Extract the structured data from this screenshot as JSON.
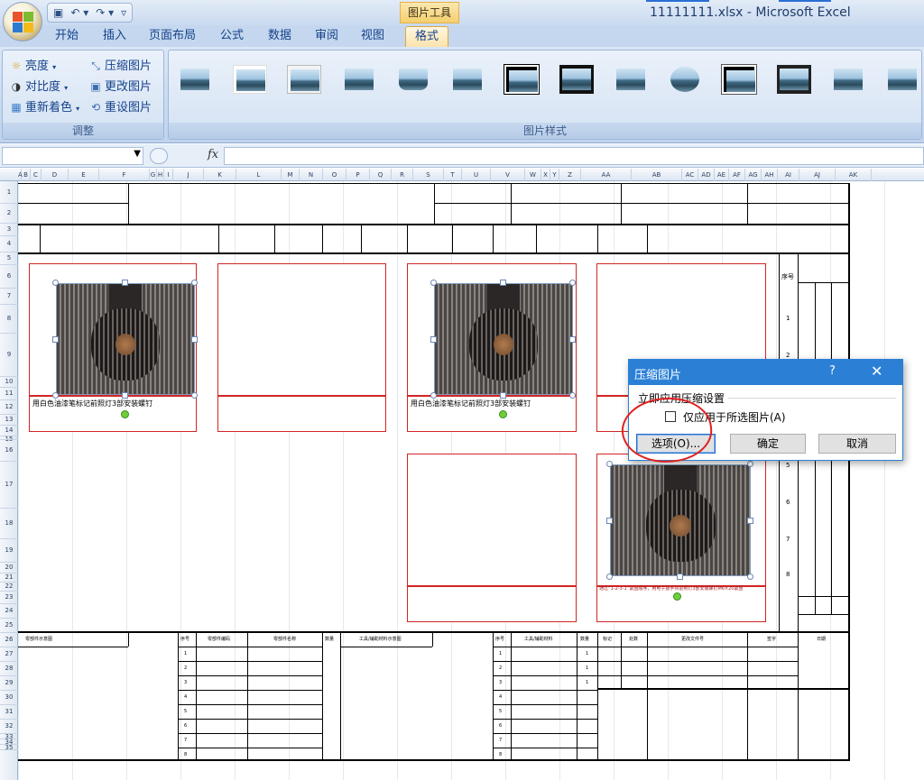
{
  "window": {
    "title": "11111111.xlsx - Microsoft Excel",
    "context_tool": "图片工具"
  },
  "tabs": [
    {
      "label": "开始"
    },
    {
      "label": "插入"
    },
    {
      "label": "页面布局"
    },
    {
      "label": "公式"
    },
    {
      "label": "数据"
    },
    {
      "label": "审阅"
    },
    {
      "label": "视图"
    },
    {
      "label": "格式",
      "active": true
    }
  ],
  "ribbon": {
    "adjust": {
      "brightness": "亮度",
      "contrast": "对比度",
      "recolor": "重新着色",
      "compress": "压缩图片",
      "change": "更改图片",
      "reset": "重设图片",
      "group_label": "调整"
    },
    "styles": {
      "group_label": "图片样式",
      "count": 14
    }
  },
  "formula_bar": {
    "fx": "fx",
    "name_value": "",
    "formula_value": ""
  },
  "sheet": {
    "columns": [
      "A",
      "B",
      "C",
      "D",
      "E",
      "F",
      "G",
      "H",
      "I",
      "J",
      "K",
      "L",
      "M",
      "N",
      "O",
      "P",
      "Q",
      "R",
      "S",
      "T",
      "U",
      "V",
      "W",
      "X",
      "Y",
      "Z",
      "AA",
      "AB",
      "AC",
      "AD",
      "AE",
      "AF",
      "AG",
      "AH",
      "AI",
      "AJ",
      "AK"
    ],
    "rows": [
      "1",
      "2",
      "3",
      "4",
      "5",
      "6",
      "7",
      "8",
      "9",
      "10",
      "11",
      "12",
      "13",
      "14",
      "15",
      "16",
      "17",
      "18",
      "19",
      "20",
      "21",
      "22",
      "23",
      "24",
      "25",
      "26",
      "27",
      "28",
      "29",
      "30",
      "31",
      "32",
      "33",
      "34",
      "35"
    ],
    "caption1": "用白色油漆笔标记前照灯3部安装螺钉",
    "caption2": "用白色油漆笔标记前照灯3部安装螺钉",
    "caption3": "通过“1-2-3-1”紧固顺序，用电子扳手将前照灯3部安装螺钉M6×20紧固",
    "seq_header": "序号",
    "seq_numbers": [
      "1",
      "2",
      "3",
      "4",
      "5",
      "6",
      "7",
      "8"
    ],
    "bottom": {
      "parts_diagram": "零部件示意图",
      "seq": "序号",
      "part_code": "零部件编码",
      "part_name": "零部件名称",
      "qty": "数量",
      "tools_diagram": "工具/辅助材料示意图",
      "tools": "工具/辅助材料",
      "mark": "标记",
      "count": "处数",
      "change_doc": "更改文件号",
      "sign": "签字",
      "date": "日期",
      "rows": [
        "1",
        "2",
        "3",
        "4",
        "5",
        "6",
        "7",
        "8"
      ],
      "tools_qty": [
        "1",
        "1",
        "1"
      ]
    }
  },
  "dialog": {
    "title": "压缩图片",
    "help": "?",
    "close": "✕",
    "section": "立即应用压缩设置",
    "checkbox": "仅应用于所选图片(A)",
    "options_btn": "选项(O)...",
    "ok_btn": "确定",
    "cancel_btn": "取消"
  }
}
